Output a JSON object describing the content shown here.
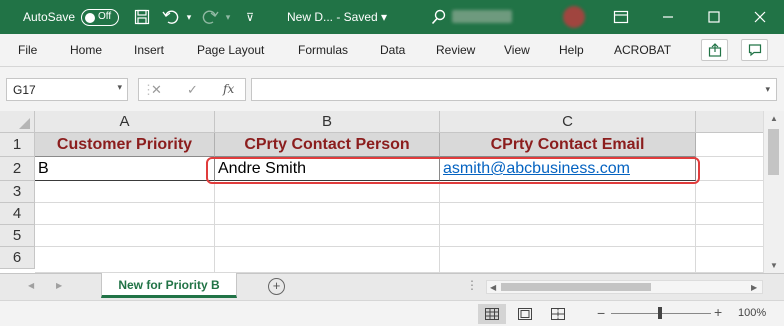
{
  "titlebar": {
    "autosave_label": "AutoSave",
    "autosave_state": "Off",
    "title": "New D...  -  Saved",
    "title_dropdown": "▾"
  },
  "ribbon": {
    "tabs": [
      "File",
      "Home",
      "Insert",
      "Page Layout",
      "Formulas",
      "Data",
      "Review",
      "View",
      "Help",
      "ACROBAT"
    ]
  },
  "formula_bar": {
    "name_box": "G17",
    "fx_label": "fx",
    "formula": ""
  },
  "grid": {
    "columns": [
      "A",
      "B",
      "C"
    ],
    "rows": [
      "1",
      "2",
      "3",
      "4",
      "5",
      "6"
    ],
    "header_row": [
      "Customer Priority",
      "CPrty Contact Person",
      "CPrty Contact Email"
    ],
    "data_row": [
      "B",
      "Andre Smith",
      "asmith@abcbusiness.com"
    ]
  },
  "sheets": {
    "active_tab": "New for Priority B",
    "add_label": "+"
  },
  "status": {
    "zoom": "100%",
    "zoom_minus": "−",
    "zoom_plus": "+"
  },
  "colors": {
    "brand": "#217346",
    "header_text": "#8b1d1d",
    "header_fill": "#d9d9d9",
    "link": "#0563c1",
    "highlight": "#e03c3c"
  }
}
